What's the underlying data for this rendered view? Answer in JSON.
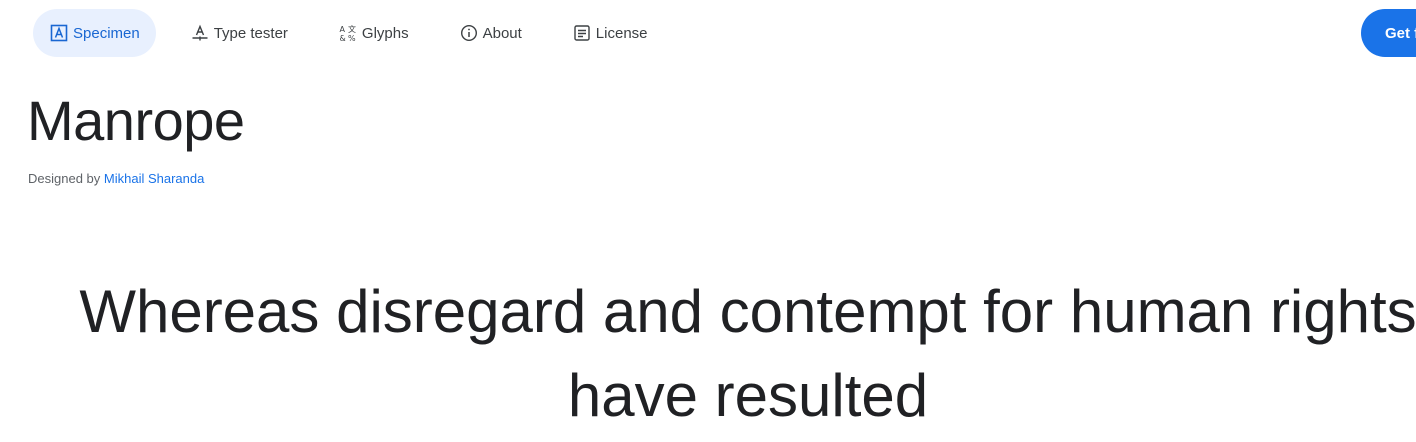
{
  "nav": {
    "tabs": [
      {
        "label": "Specimen",
        "icon": "specimen-icon",
        "active": true
      },
      {
        "label": "Type tester",
        "icon": "type-tester-icon",
        "active": false
      },
      {
        "label": "Glyphs",
        "icon": "glyphs-icon",
        "active": false
      },
      {
        "label": "About",
        "icon": "info-icon",
        "active": false
      },
      {
        "label": "License",
        "icon": "license-icon",
        "active": false
      }
    ],
    "get_button_label": "Get f"
  },
  "family": {
    "name": "Manrope",
    "designed_by_prefix": "Designed by",
    "designer": "Mikhail Sharanda"
  },
  "specimen": {
    "line1": "Whereas disregard and contempt for human rights",
    "line2": "have resulted"
  },
  "colors": {
    "accent": "#1a73e8",
    "active_tab_bg": "#e8f0fe",
    "active_tab_text": "#1967d2",
    "text": "#202124"
  }
}
